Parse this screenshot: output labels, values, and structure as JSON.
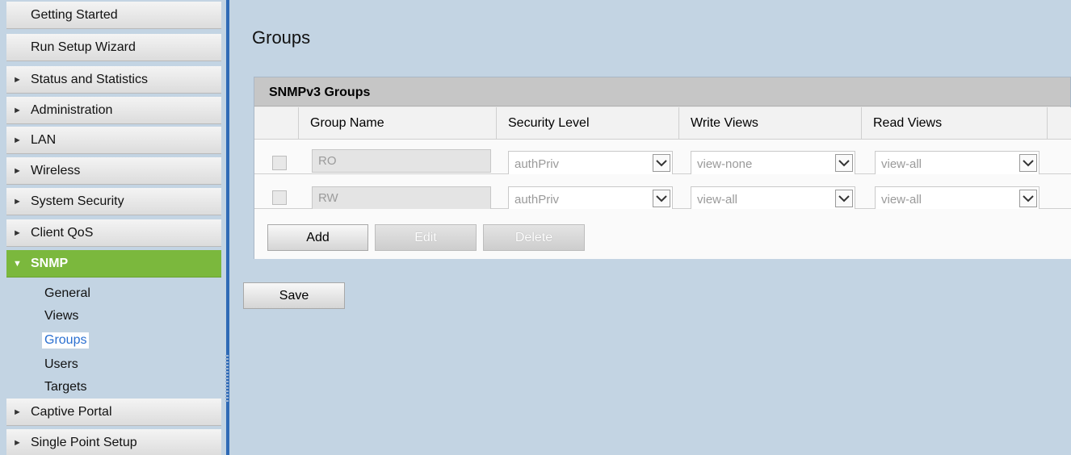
{
  "sidebar": {
    "items": [
      {
        "label": "Getting Started"
      },
      {
        "label": "Run Setup Wizard"
      },
      {
        "label": "Status and Statistics"
      },
      {
        "label": "Administration"
      },
      {
        "label": "LAN"
      },
      {
        "label": "Wireless"
      },
      {
        "label": "System Security"
      },
      {
        "label": "Client QoS"
      },
      {
        "label": "SNMP"
      },
      {
        "label": "Captive Portal"
      },
      {
        "label": "Single Point Setup"
      }
    ],
    "snmp_subitems": [
      {
        "label": "General"
      },
      {
        "label": "Views"
      },
      {
        "label": "Groups"
      },
      {
        "label": "Users"
      },
      {
        "label": "Targets"
      }
    ],
    "selected_subitem": "Groups"
  },
  "main": {
    "title": "Groups",
    "panel": {
      "title": "SNMPv3 Groups",
      "columns": [
        "Group Name",
        "Security Level",
        "Write Views",
        "Read Views"
      ],
      "rows": [
        {
          "name": "RO",
          "security": "authPriv",
          "write": "view-none",
          "read": "view-all"
        },
        {
          "name": "RW",
          "security": "authPriv",
          "write": "view-all",
          "read": "view-all"
        }
      ],
      "buttons": {
        "add": "Add",
        "edit": "Edit",
        "delete": "Delete"
      }
    },
    "save_label": "Save"
  },
  "colors": {
    "accent_green": "#7bb83d",
    "divider_blue": "#2f6ab6",
    "background": "#c3d4e3"
  },
  "icons": {
    "expand": "triangle-right-icon",
    "collapse": "triangle-down-icon",
    "dropdown": "chevron-down-icon"
  }
}
